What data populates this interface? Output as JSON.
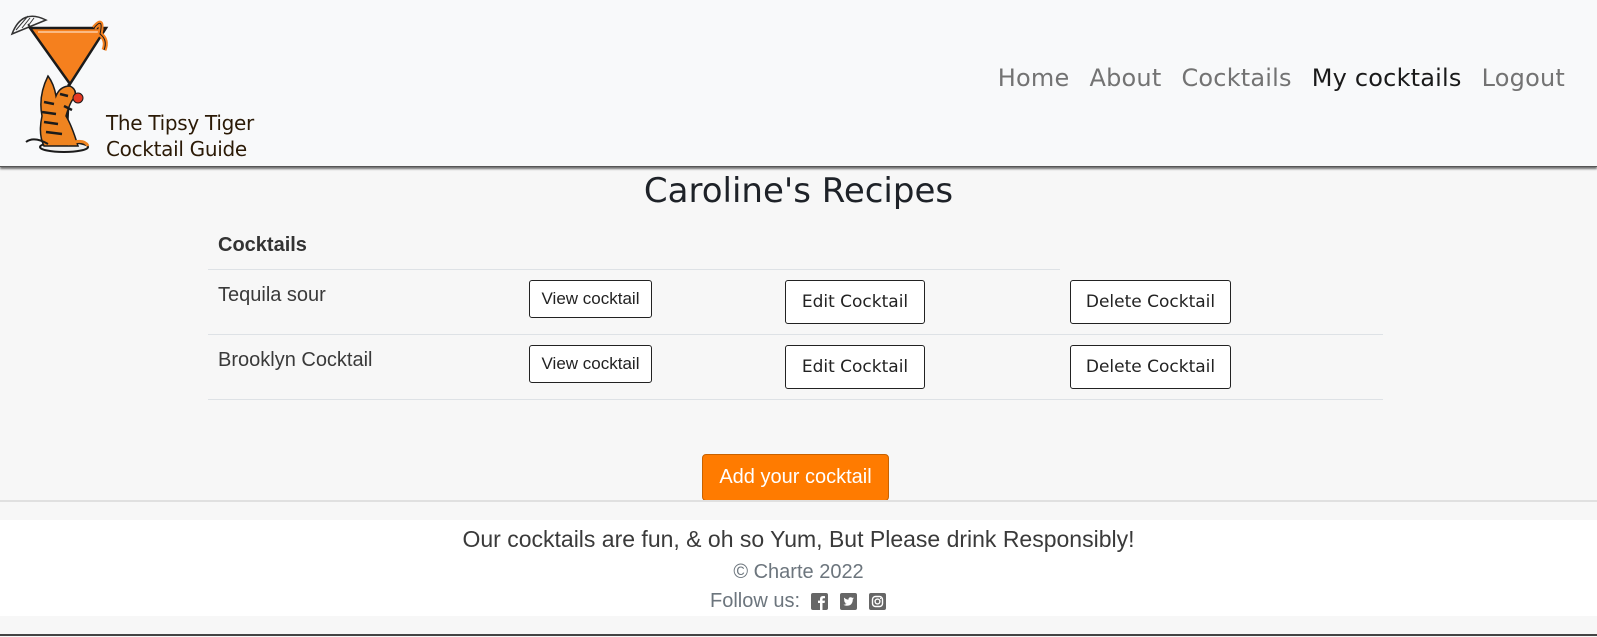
{
  "brand": {
    "line1": "The Tipsy Tiger",
    "line2": "Cocktail Guide"
  },
  "nav": {
    "home": "Home",
    "about": "About",
    "cocktails": "Cocktails",
    "my_cocktails": "My cocktails",
    "logout": "Logout",
    "active": "My cocktails"
  },
  "page": {
    "title": "Caroline's Recipes"
  },
  "table": {
    "header": "Cocktails",
    "rows": [
      {
        "name": "Tequila sour",
        "view": "View cocktail",
        "edit": "Edit Cocktail",
        "delete": "Delete Cocktail"
      },
      {
        "name": "Brooklyn Cocktail",
        "view": "View cocktail",
        "edit": "Edit Cocktail",
        "delete": "Delete Cocktail"
      }
    ]
  },
  "actions": {
    "add": "Add your cocktail"
  },
  "footer": {
    "tagline": "Our cocktails are fun, & oh so Yum, But Please drink Responsibly!",
    "copyright": "© Charte 2022",
    "follow": "Follow us:",
    "social": [
      "facebook-icon",
      "twitter-icon",
      "instagram-icon"
    ]
  },
  "colors": {
    "accent": "#ff7b00",
    "header_bg": "#f8f9fa",
    "page_bg": "#f7f7f7"
  }
}
